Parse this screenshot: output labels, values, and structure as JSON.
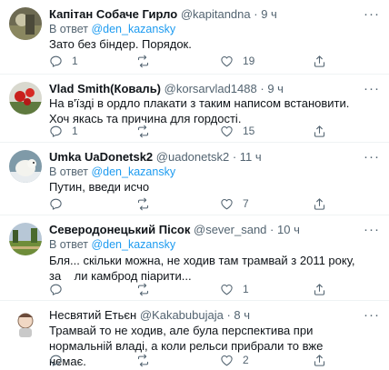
{
  "reply_prefix": "В ответ",
  "tweets": [
    {
      "name": "Капітан Собаче Гирло",
      "handle": "@kapitandna",
      "time": "9 ч",
      "reply_to": "@den_kazansky",
      "text": "Зато без біндер. Порядок.",
      "replies": "1",
      "retweets": "",
      "likes": "19"
    },
    {
      "name": "Vlad Smith(Коваль)",
      "handle": "@korsarvlad1488",
      "time": "9 ч",
      "reply_to": "",
      "text": "На в'їзді в ордло плакати з таким написом встановити. Хоч якась та причина для гордості.",
      "replies": "1",
      "retweets": "",
      "likes": "15"
    },
    {
      "name": "Umka UaDonetsk2",
      "handle": "@uadonetsk2",
      "time": "11 ч",
      "reply_to": "@den_kazansky",
      "text": "Путин, введи исчо",
      "replies": "",
      "retweets": "",
      "likes": "7"
    },
    {
      "name": "Северодонецький Пісок",
      "handle": "@sever_sand",
      "time": "10 ч",
      "reply_to": "@den_kazansky",
      "text": "Бля... скільки можна, не ходив там трамвай з 2011 року, за    ли камброд піарити...",
      "replies": "",
      "retweets": "",
      "likes": "1"
    },
    {
      "name": "Несвятий Етьєн",
      "handle": "@Kakabubujaja",
      "time": "8 ч",
      "reply_to": "",
      "text": "Трамвай то не ходив, але була перспектива при нормальній владі, а коли рельси прибрали то вже немає.",
      "replies": "",
      "retweets": "",
      "likes": "2"
    }
  ]
}
